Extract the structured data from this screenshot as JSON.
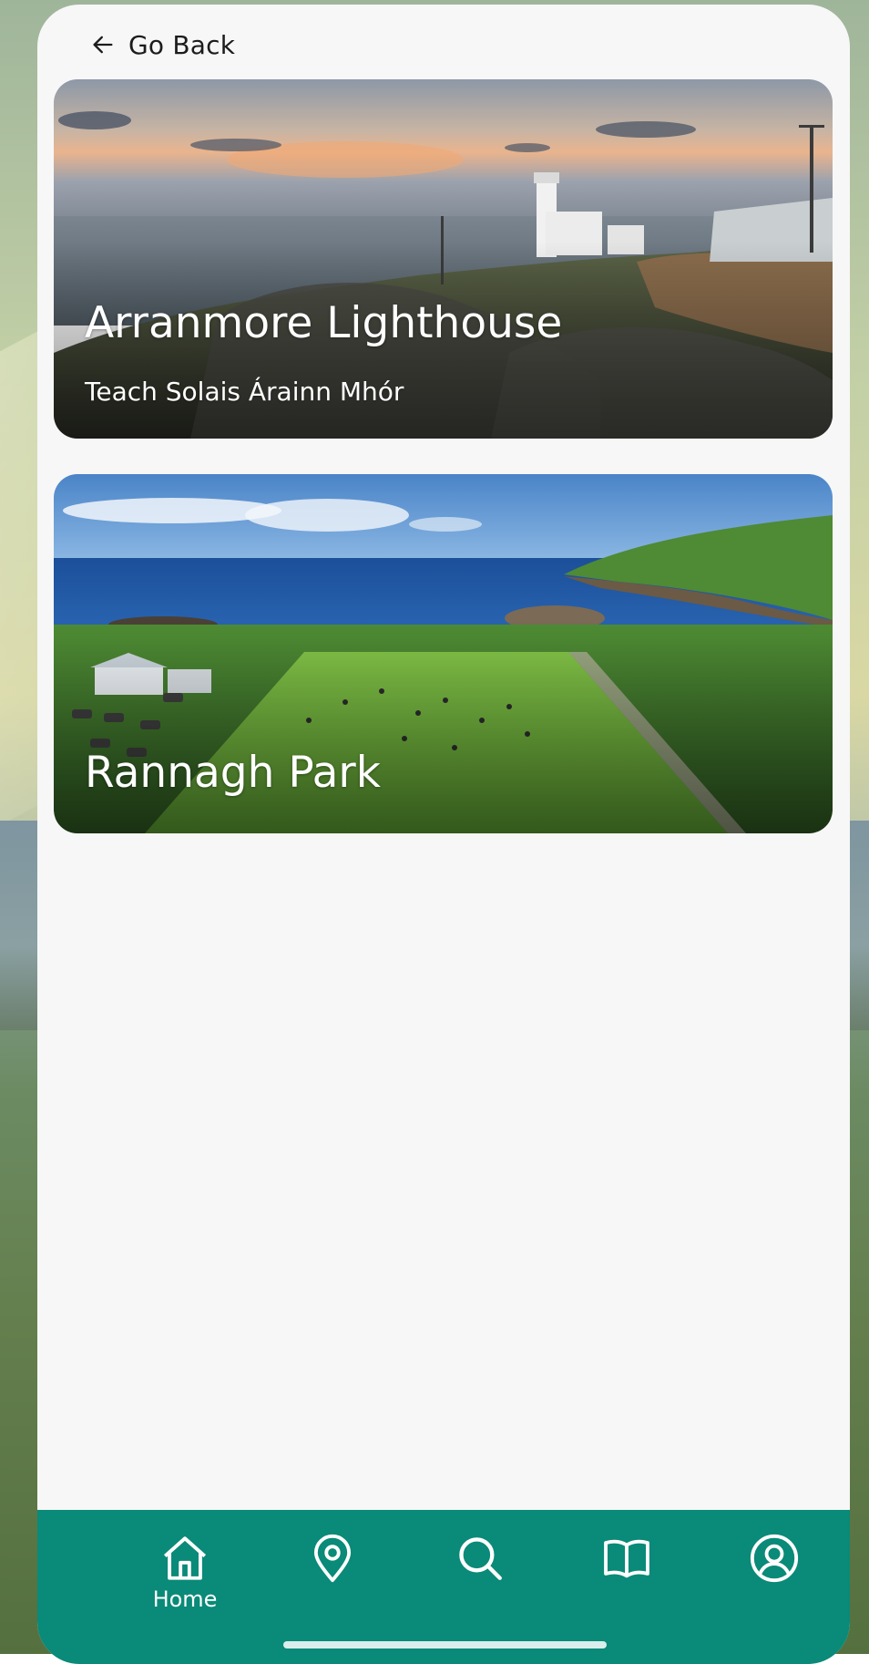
{
  "header": {
    "back_label": "Go Back"
  },
  "cards": [
    {
      "title": "Arranmore Lighthouse",
      "subtitle": "Teach Solais Árainn Mhór"
    },
    {
      "title": "Rannagh Park"
    }
  ],
  "bottom_nav": {
    "items": [
      {
        "label": "Home",
        "icon": "home-icon",
        "active": true
      },
      {
        "label": "",
        "icon": "map-pin-icon",
        "active": false
      },
      {
        "label": "",
        "icon": "search-icon",
        "active": false
      },
      {
        "label": "",
        "icon": "book-icon",
        "active": false
      },
      {
        "label": "",
        "icon": "profile-icon",
        "active": false
      }
    ]
  },
  "colors": {
    "nav_background": "#0a8a78",
    "page_background": "#f7f7f7",
    "text_on_image": "#ffffff"
  }
}
